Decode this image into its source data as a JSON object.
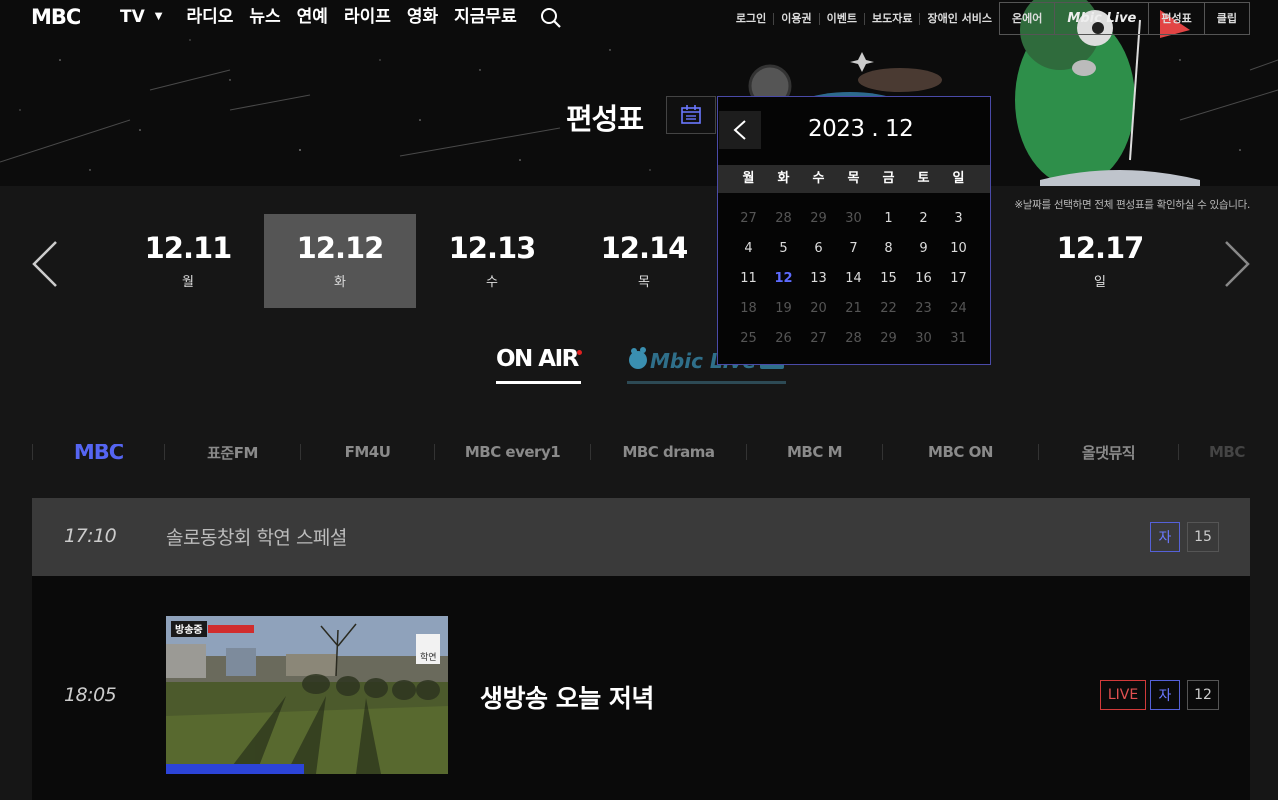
{
  "header": {
    "logo": "MBC",
    "nav": [
      "TV",
      "라디오",
      "뉴스",
      "연예",
      "라이프",
      "영화",
      "지금무료"
    ],
    "tv_caret": "▼",
    "util_links": [
      "로그인",
      "이용권",
      "이벤트",
      "보도자료",
      "장애인 서비스"
    ],
    "util_boxed": [
      "온에어",
      "Mbic Live",
      "편성표",
      "클립"
    ]
  },
  "page": {
    "title": "편성표",
    "notice": "※날짜를 선택하면 전체 편성표를 확인하실 수 있습니다."
  },
  "dates": [
    {
      "date": "12.11",
      "weekday": "월"
    },
    {
      "date": "12.12",
      "weekday": "화",
      "active": true
    },
    {
      "date": "12.13",
      "weekday": "수"
    },
    {
      "date": "12.14",
      "weekday": "목"
    },
    {
      "date": "12.17",
      "weekday": "일"
    }
  ],
  "tabs": {
    "onair": "ON AIR",
    "mlive": "Mbic Live"
  },
  "channels": [
    "MBC",
    "표준FM",
    "FM4U",
    "MBC every1",
    "MBC drama",
    "MBC M",
    "MBC ON",
    "올댓뮤직",
    "MBC"
  ],
  "schedule": [
    {
      "time": "17:10",
      "title": "솔로동창회 학연 스페셜",
      "sub": "자",
      "rating": "15"
    },
    {
      "time": "18:05",
      "title": "생방송 오늘 저녁",
      "live": "LIVE",
      "sub": "자",
      "rating": "12",
      "thumb_badge": "방송중",
      "thumb_tag": "학연"
    }
  ],
  "calendar": {
    "year_month": "2023 . 12",
    "weekdays": [
      "월",
      "화",
      "수",
      "목",
      "금",
      "토",
      "일"
    ],
    "weeks": [
      [
        "27",
        "28",
        "29",
        "30",
        "1",
        "2",
        "3"
      ],
      [
        "4",
        "5",
        "6",
        "7",
        "8",
        "9",
        "10"
      ],
      [
        "11",
        "12",
        "13",
        "14",
        "15",
        "16",
        "17"
      ],
      [
        "18",
        "19",
        "20",
        "21",
        "22",
        "23",
        "24"
      ],
      [
        "25",
        "26",
        "27",
        "28",
        "29",
        "30",
        "31"
      ]
    ],
    "selected": "12"
  },
  "colors": {
    "accent": "#5565f2",
    "live_red": "#d23a3a",
    "active_day_bg": "#555555",
    "row_bg": "#3a3a3a"
  }
}
